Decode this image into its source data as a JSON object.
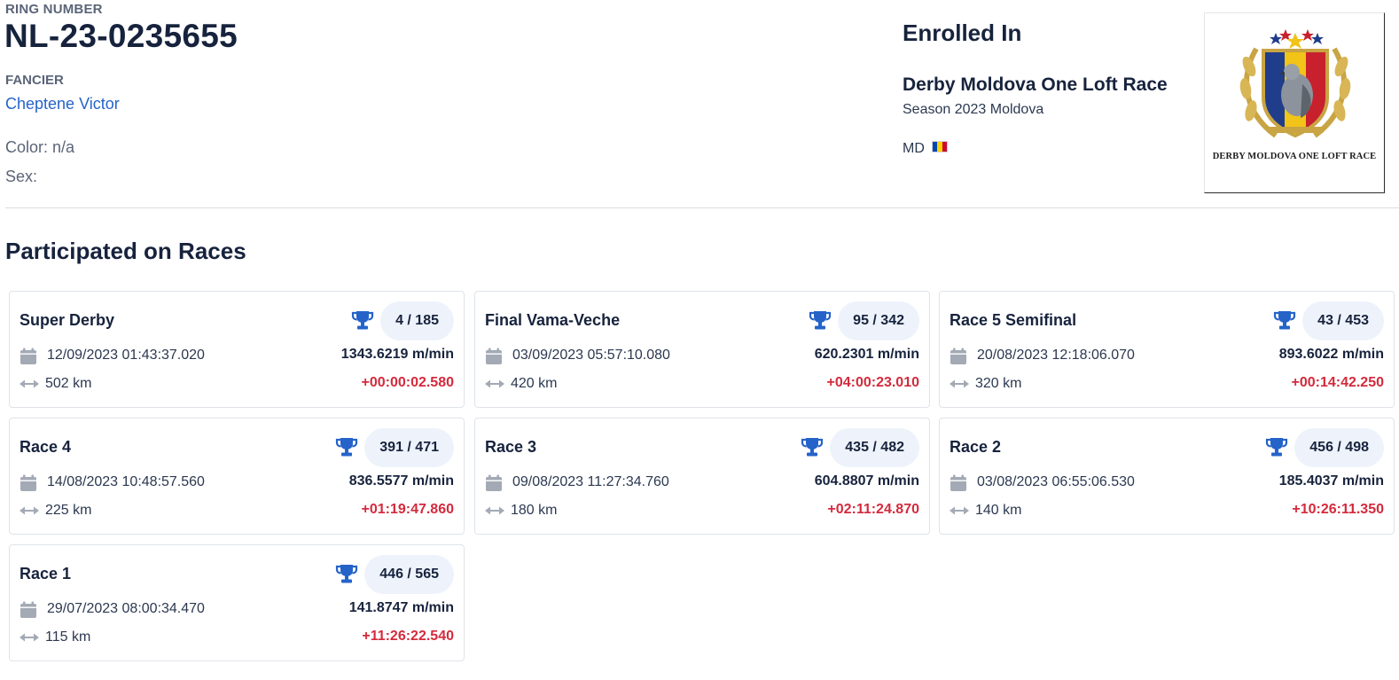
{
  "header": {
    "ring_label": "RING NUMBER",
    "ring_number": "NL-23-0235655",
    "fancier_label": "FANCIER",
    "fancier_name": "Cheptene Victor",
    "color_line": "Color: n/a",
    "sex_line": "Sex:"
  },
  "enrollment": {
    "title": "Enrolled In",
    "race_name": "Derby Moldova One Loft Race",
    "season": "Season 2023 Moldova",
    "country_code": "MD",
    "flag_colors": [
      "#0046AE",
      "#FFD200",
      "#CC092F"
    ],
    "logo_text": "DERBY MOLDOVA ONE LOFT RACE"
  },
  "races_section": {
    "title": "Participated on Races"
  },
  "colors": {
    "accent_blue": "#2563c9",
    "delay_red": "#d42a3c",
    "icon_gray": "#a3aab5"
  },
  "races": [
    {
      "name": "Super Derby",
      "rank": "4 / 185",
      "date": "12/09/2023 01:43:37.020",
      "speed": "1343.6219 m/min",
      "distance": "502 km",
      "delay": "+00:00:02.580"
    },
    {
      "name": "Final Vama-Veche",
      "rank": "95 / 342",
      "date": "03/09/2023 05:57:10.080",
      "speed": "620.2301 m/min",
      "distance": "420 km",
      "delay": "+04:00:23.010"
    },
    {
      "name": "Race 5 Semifinal",
      "rank": "43 / 453",
      "date": "20/08/2023 12:18:06.070",
      "speed": "893.6022 m/min",
      "distance": "320 km",
      "delay": "+00:14:42.250"
    },
    {
      "name": "Race 4",
      "rank": "391 / 471",
      "date": "14/08/2023 10:48:57.560",
      "speed": "836.5577 m/min",
      "distance": "225 km",
      "delay": "+01:19:47.860"
    },
    {
      "name": "Race 3",
      "rank": "435 / 482",
      "date": "09/08/2023 11:27:34.760",
      "speed": "604.8807 m/min",
      "distance": "180 km",
      "delay": "+02:11:24.870"
    },
    {
      "name": "Race 2",
      "rank": "456 / 498",
      "date": "03/08/2023 06:55:06.530",
      "speed": "185.4037 m/min",
      "distance": "140 km",
      "delay": "+10:26:11.350"
    },
    {
      "name": "Race 1",
      "rank": "446 / 565",
      "date": "29/07/2023 08:00:34.470",
      "speed": "141.8747 m/min",
      "distance": "115 km",
      "delay": "+11:26:22.540"
    }
  ]
}
